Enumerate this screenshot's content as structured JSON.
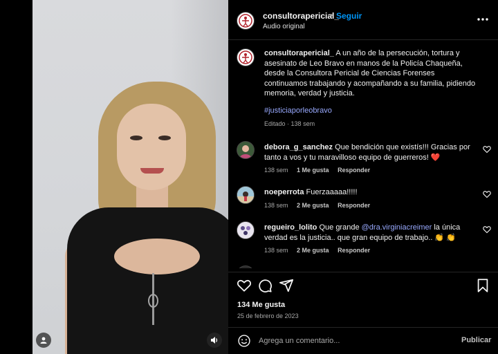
{
  "post": {
    "username": "consultorapericial_",
    "follow_label": "Seguir",
    "dot": "•",
    "audio_label": "Audio original"
  },
  "caption": {
    "username": "consultorapericial_",
    "text": "A un año de la persecución, tortura y asesinato de Leo Bravo en manos de la Policía Chaqueña, desde la Consultora Pericial de Ciencias Forenses continuamos trabajando y acompañando a su familia, pidiendo memoria, verdad y justicia.",
    "hashtag": "#justiciaporleobravo",
    "edited_label": "Editado",
    "age": "138 sem"
  },
  "comments": [
    {
      "username": "debora_g_sanchez",
      "text": "Que bendición que existís!!! Gracias por tanto a vos y tu maravilloso equipo de guerreros! ❤️",
      "age": "138 sem",
      "likes": "1 Me gusta",
      "reply": "Responder"
    },
    {
      "username": "noeperrota",
      "text": "Fuerzaaaaa!!!!!",
      "age": "138 sem",
      "likes": "2 Me gusta",
      "reply": "Responder"
    },
    {
      "username": "regueiro_lolito",
      "text_before": "Que grande",
      "mention": "@dra.virginiacreimer",
      "text_after": "la única verdad es la justicia.. que gran equipo de trabajo.. 👏 👏",
      "age": "138 sem",
      "likes": "2 Me gusta",
      "reply": "Responder"
    }
  ],
  "actions": {
    "likes_label": "134 Me gusta",
    "date": "25 de febrero de 2023"
  },
  "comment_box": {
    "placeholder": "Agrega un comentario...",
    "post_label": "Publicar"
  },
  "icons": {
    "more": "more-options-icon",
    "like": "heart-icon",
    "comment": "comment-icon",
    "share": "share-icon",
    "save": "bookmark-icon",
    "emoji": "emoji-icon",
    "user": "user-tag-icon",
    "sound": "speaker-icon"
  },
  "colors": {
    "background": "#000000",
    "link": "#0095f6",
    "hashtag": "#99aaff",
    "muted": "#a8a8a8"
  }
}
